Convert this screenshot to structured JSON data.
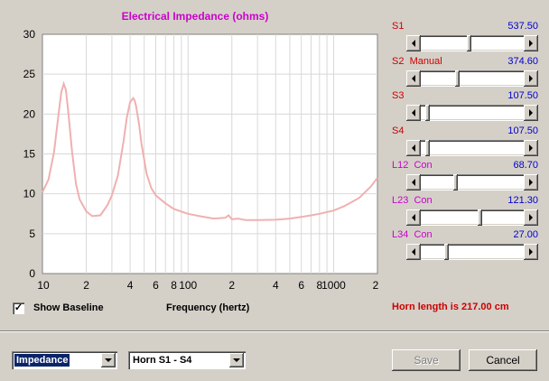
{
  "chart_data": {
    "type": "line",
    "title": "Electrical Impedance (ohms)",
    "xlabel": "Frequency (hertz)",
    "ylabel": "",
    "x_scale": "log",
    "xlim": [
      10,
      2000
    ],
    "ylim": [
      0,
      30
    ],
    "y_ticks": [
      "0",
      "5",
      "10",
      "15",
      "20",
      "25",
      "30"
    ],
    "x_ticks": [
      "10",
      "2",
      "4",
      "6",
      "8",
      "100",
      "2",
      "4",
      "6",
      "8",
      "1000",
      "2"
    ],
    "grid": true,
    "series": [
      {
        "color": "#f0b0b0",
        "x": [
          10,
          11,
          12,
          13,
          13.5,
          14,
          14.5,
          15,
          16,
          17,
          18,
          20,
          22,
          25,
          28,
          30,
          33,
          36,
          38,
          40,
          42,
          43,
          44,
          46,
          48,
          52,
          56,
          60,
          70,
          80,
          100,
          120,
          150,
          180,
          190,
          200,
          220,
          250,
          300,
          400,
          500,
          600,
          700,
          800,
          1000,
          1200,
          1500,
          1800,
          2000
        ],
        "y": [
          10.2,
          11.8,
          15.2,
          20.5,
          22.8,
          23.8,
          23.0,
          20.5,
          15.2,
          11.2,
          9.3,
          7.8,
          7.2,
          7.3,
          8.6,
          9.8,
          12.3,
          16.5,
          19.6,
          21.5,
          22.0,
          21.7,
          21.0,
          18.8,
          16.2,
          12.5,
          10.7,
          9.8,
          8.8,
          8.1,
          7.5,
          7.2,
          6.9,
          7.0,
          7.3,
          6.8,
          6.9,
          6.7,
          6.7,
          6.75,
          6.9,
          7.1,
          7.3,
          7.5,
          7.9,
          8.5,
          9.5,
          10.9,
          12.0
        ]
      }
    ]
  },
  "colors": {
    "title": "#cc00cc",
    "slider_label_red": "#cc0000",
    "slider_label_magenta": "#cc00cc",
    "slider_value": "#0000cc",
    "curve": "#f0b0b0",
    "horn_text": "#cc0000"
  },
  "sliders": [
    {
      "name": "S1",
      "label": "S1",
      "value": "537.50",
      "color": "red",
      "level": 0.47
    },
    {
      "name": "S2",
      "label": "S2  Manual",
      "value": "374.60",
      "color": "red",
      "level": 0.35
    },
    {
      "name": "S3",
      "label": "S3",
      "value": "107.50",
      "color": "red",
      "level": 0.05
    },
    {
      "name": "S4",
      "label": "S4",
      "value": "107.50",
      "color": "red",
      "level": 0.05
    },
    {
      "name": "L12",
      "label": "L12  Con",
      "value": "68.70",
      "color": "magenta",
      "level": 0.33
    },
    {
      "name": "L23",
      "label": "L23  Con",
      "value": "121.30",
      "color": "magenta",
      "level": 0.58
    },
    {
      "name": "L34",
      "label": "L34  Con",
      "value": "27.00",
      "color": "magenta",
      "level": 0.24
    }
  ],
  "show_baseline": {
    "label": "Show Baseline",
    "checked": true,
    "check_glyph": "✓"
  },
  "horn_length": "Horn length is 217.00 cm",
  "view_select": {
    "selected": "Impedance"
  },
  "horn_select": {
    "selected": "Horn S1 - S4"
  },
  "buttons": {
    "save": "Save",
    "cancel": "Cancel"
  }
}
